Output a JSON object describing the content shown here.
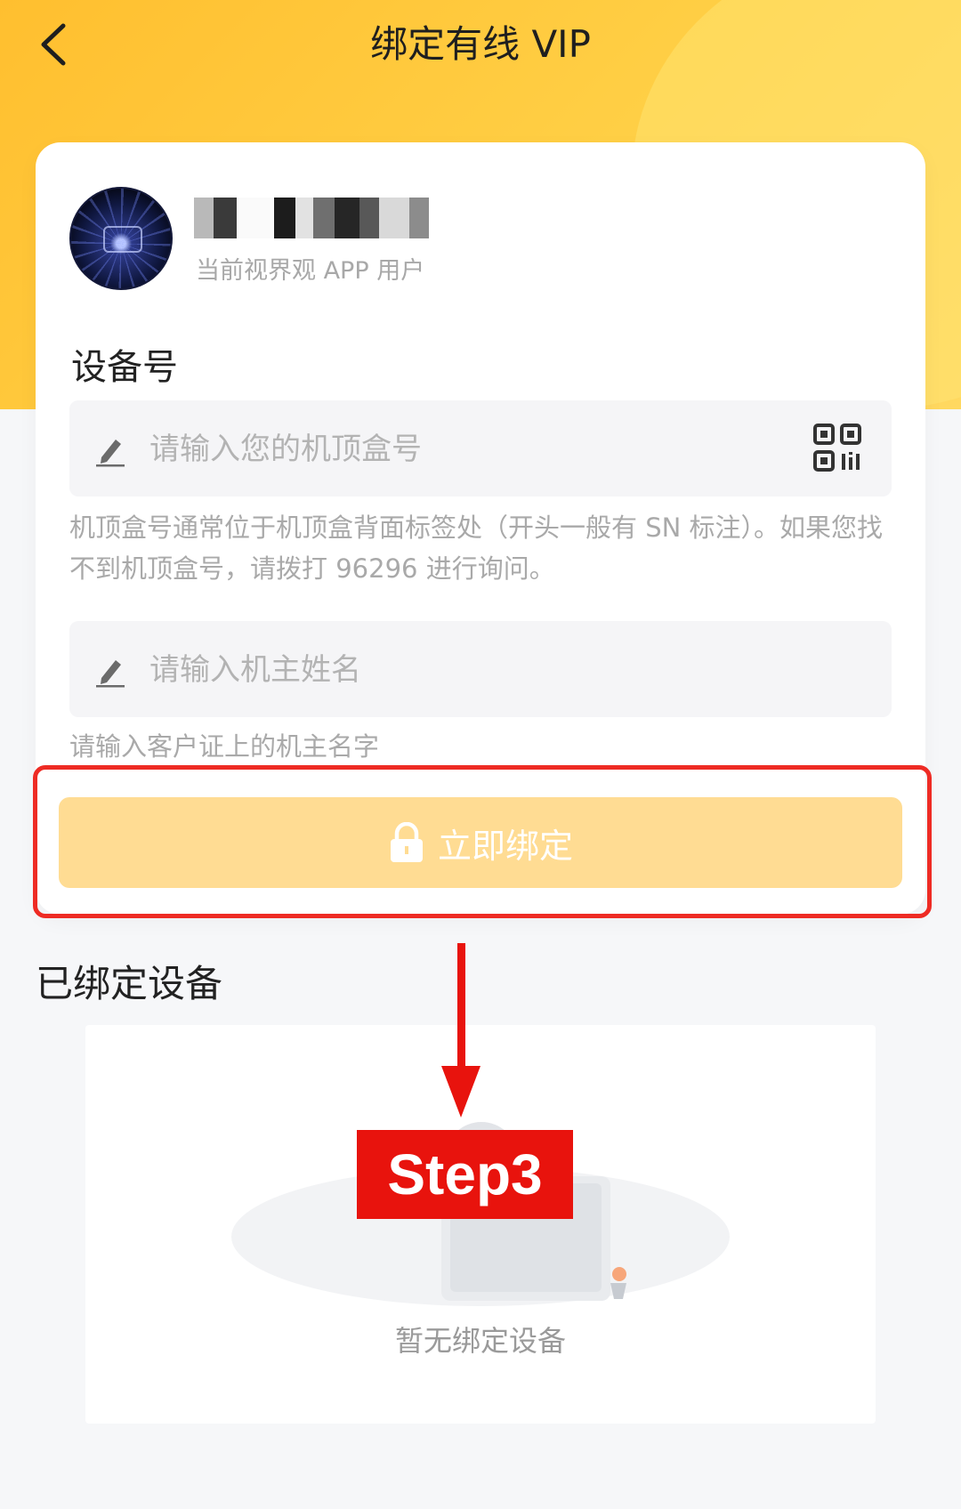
{
  "header": {
    "title": "绑定有线 VIP",
    "back_icon": "chevron-left-icon"
  },
  "user": {
    "subtitle": "当前视界观 APP 用户"
  },
  "form": {
    "device_label": "设备号",
    "device_placeholder": "请输入您的机顶盒号",
    "device_hint": "机顶盒号通常位于机顶盒背面标签处（开头一般有 SN 标注）。如果您找不到机顶盒号，请拨打 96296 进行询问。",
    "owner_placeholder": "请输入机主姓名",
    "owner_hint": "请输入客户证上的机主名字",
    "bind_button_label": "立即绑定"
  },
  "bound": {
    "title": "已绑定设备",
    "empty_text": "暂无绑定设备"
  },
  "annotation": {
    "step_label": "Step3"
  },
  "colors": {
    "header_yellow": "#ffc43a",
    "button_disabled": "#ffdc93",
    "annotation_red": "#e8130d"
  }
}
